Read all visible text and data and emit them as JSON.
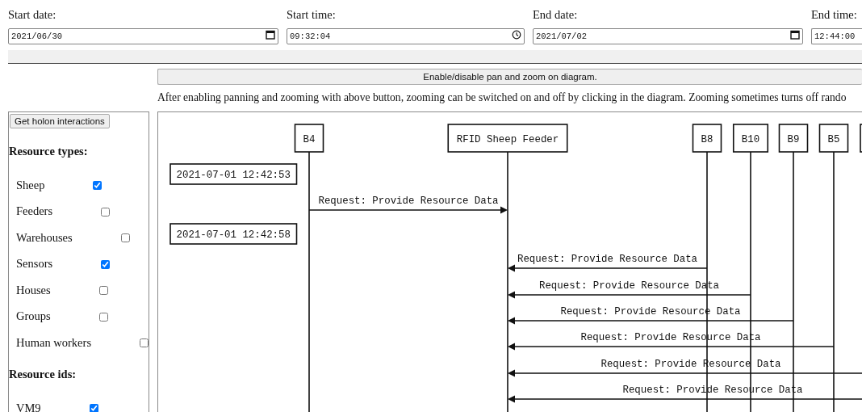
{
  "filters": [
    {
      "label": "Start date:",
      "value": "2021/06/30",
      "kind": "date"
    },
    {
      "label": "Start time:",
      "value": "09:32:04",
      "kind": "time"
    },
    {
      "label": "End date:",
      "value": "2021/07/02",
      "kind": "date"
    },
    {
      "label": "End time:",
      "value": "12:44:00",
      "kind": "time"
    }
  ],
  "pan_zoom_button": "Enable/disable pan and zoom on diagram.",
  "hint": "After enabling panning and zooming with above button, zooming can be switched on and off by clicking in the diagram. Zooming sometimes turns off rando",
  "sidebar": {
    "button": "Get holon interactions",
    "sections": [
      {
        "title": "Resource types:",
        "items": [
          {
            "label": "Sheep",
            "checked": true
          },
          {
            "label": "Feeders",
            "checked": false
          },
          {
            "label": "Warehouses",
            "checked": false
          },
          {
            "label": "Sensors",
            "checked": true
          },
          {
            "label": "Houses",
            "checked": false
          },
          {
            "label": "Groups",
            "checked": false
          },
          {
            "label": "Human workers",
            "checked": false
          }
        ]
      },
      {
        "title": "Resource ids:",
        "items": [
          {
            "label": "VM9",
            "checked": true
          }
        ]
      }
    ]
  },
  "diagram": {
    "lifelines": [
      {
        "label": "B4",
        "kind": "sender"
      },
      {
        "label": "RFID Sheep Feeder",
        "kind": "target"
      },
      {
        "label": "B8",
        "kind": "sender"
      },
      {
        "label": "B10",
        "kind": "sender"
      },
      {
        "label": "B9",
        "kind": "sender"
      },
      {
        "label": "B5",
        "kind": "sender"
      },
      {
        "kind": "partial"
      }
    ],
    "timestamps": [
      "2021-07-01 12:42:53",
      "2021-07-01 12:42:58"
    ],
    "messages": [
      {
        "label": "Request: Provide Resource Data",
        "from_right": false
      },
      {
        "label": "Request: Provide Resource Data",
        "from_right": true
      },
      {
        "label": "Request: Provide Resource Data",
        "from_right": true
      },
      {
        "label": "Request: Provide Resource Data",
        "from_right": true
      },
      {
        "label": "Request: Provide Resource Data",
        "from_right": true
      },
      {
        "label": "Request: Provide Resource Data",
        "from_right": true
      },
      {
        "label": "Request: Provide Resource Data",
        "from_right": true
      }
    ]
  }
}
